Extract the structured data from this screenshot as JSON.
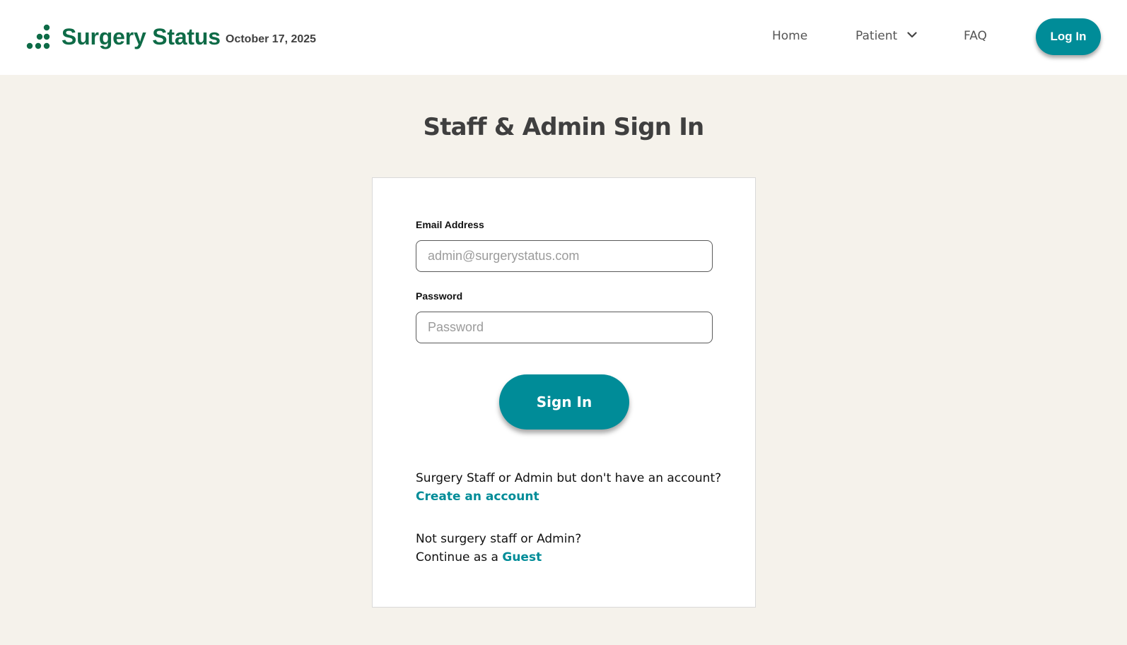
{
  "header": {
    "brand_name": "Surgery Status",
    "date": "October 17, 2025",
    "nav": {
      "home": "Home",
      "patient": "Patient",
      "faq": "FAQ"
    },
    "login_label": "Log In"
  },
  "main": {
    "title": "Staff & Admin Sign In",
    "form": {
      "email_label": "Email Address",
      "email_placeholder": "admin@surgerystatus.com",
      "password_label": "Password",
      "password_placeholder": "Password",
      "submit_label": "Sign In"
    },
    "create_account": {
      "prompt": "Surgery Staff or Admin but don't have an account?",
      "link_label": "Create an account"
    },
    "guest": {
      "prompt": "Not surgery staff or Admin?",
      "prefix": "Continue as a",
      "link_label": "Guest"
    }
  },
  "colors": {
    "brand_green": "#0e6b47",
    "accent_teal": "#008c98",
    "page_background": "#f5f2eb"
  },
  "icons": {
    "logo": "dot-cluster-icon",
    "patient_dropdown": "chevron-down-icon"
  }
}
